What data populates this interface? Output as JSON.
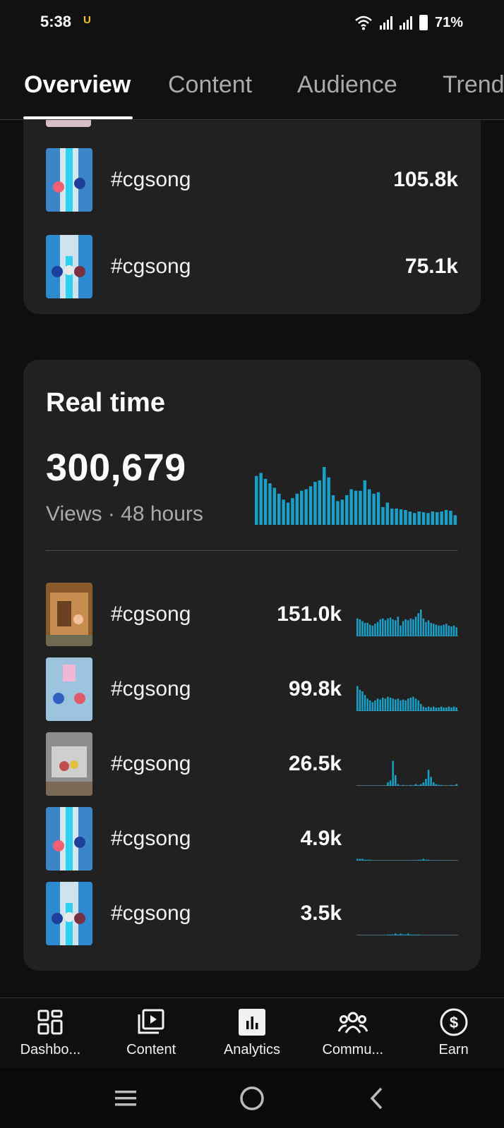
{
  "status_bar": {
    "time": "5:38",
    "app_icon": "U",
    "battery": "71%",
    "icons": [
      "wifi-icon",
      "signal-icon",
      "signal-icon",
      "battery-icon"
    ]
  },
  "tabs": [
    {
      "label": "Overview",
      "active": true
    },
    {
      "label": "Content",
      "active": false
    },
    {
      "label": "Audience",
      "active": false
    },
    {
      "label": "Trends",
      "active": false
    }
  ],
  "top_list": [
    {
      "title": "#cgsong",
      "views": "105.8k"
    },
    {
      "title": "#cgsong",
      "views": "75.1k"
    }
  ],
  "realtime": {
    "title": "Real time",
    "views": "300,679",
    "subtitle": "Views · 48 hours",
    "chart_data": {
      "type": "bar",
      "values": [
        66,
        70,
        62,
        56,
        50,
        42,
        34,
        30,
        36,
        42,
        46,
        48,
        52,
        58,
        60,
        78,
        64,
        40,
        32,
        34,
        40,
        48,
        46,
        46,
        60,
        48,
        42,
        44,
        24,
        30,
        22,
        22,
        21,
        20,
        18,
        16,
        18,
        17,
        16,
        18,
        17,
        18,
        20,
        19,
        13
      ]
    },
    "rows": [
      {
        "title": "#cgsong",
        "views": "151.0k",
        "spark": [
          20,
          19,
          17,
          15,
          15,
          13,
          12,
          14,
          16,
          19,
          20,
          18,
          20,
          21,
          19,
          18,
          22,
          12,
          17,
          19,
          18,
          20,
          19,
          22,
          26,
          30,
          20,
          16,
          18,
          15,
          14,
          13,
          12,
          12,
          13,
          14,
          12,
          11,
          12,
          10
        ]
      },
      {
        "title": "#cgsong",
        "views": "99.8k",
        "spark": [
          28,
          24,
          22,
          18,
          14,
          12,
          10,
          12,
          14,
          13,
          15,
          14,
          16,
          15,
          14,
          13,
          14,
          12,
          13,
          12,
          14,
          15,
          16,
          14,
          12,
          8,
          5,
          4,
          5,
          4,
          5,
          4,
          4,
          5,
          4,
          4,
          5,
          4,
          5,
          4
        ]
      },
      {
        "title": "#cgsong",
        "views": "26.5k",
        "spark": [
          0,
          0,
          0,
          0,
          0,
          0,
          0,
          0,
          0,
          0,
          0,
          0,
          4,
          6,
          28,
          12,
          2,
          0,
          1,
          0,
          0,
          1,
          0,
          2,
          1,
          2,
          4,
          8,
          18,
          10,
          4,
          2,
          1,
          1,
          0,
          0,
          0,
          1,
          0,
          2
        ]
      },
      {
        "title": "#cgsong",
        "views": "4.9k",
        "spark": [
          2,
          2,
          2,
          1,
          1,
          1,
          0,
          0,
          0,
          0,
          0,
          0,
          0,
          0,
          0,
          0,
          0,
          0,
          0,
          0,
          0,
          0,
          0,
          0,
          1,
          1,
          2,
          1,
          1,
          0,
          0,
          0,
          0,
          0,
          0,
          0,
          0,
          0,
          0,
          0
        ]
      },
      {
        "title": "#cgsong",
        "views": "3.5k",
        "spark": [
          0,
          0,
          0,
          0,
          0,
          0,
          0,
          0,
          0,
          0,
          0,
          0,
          1,
          1,
          1,
          2,
          1,
          2,
          1,
          1,
          2,
          1,
          1,
          1,
          1,
          0,
          0,
          0,
          0,
          0,
          0,
          0,
          0,
          0,
          0,
          0,
          0,
          0,
          0,
          0
        ]
      }
    ]
  },
  "bottom_nav": [
    {
      "label": "Dashbo...",
      "icon": "dashboard-icon",
      "active": false
    },
    {
      "label": "Content",
      "icon": "content-icon",
      "active": false
    },
    {
      "label": "Analytics",
      "icon": "analytics-icon",
      "active": true
    },
    {
      "label": "Commu...",
      "icon": "community-icon",
      "active": false
    },
    {
      "label": "Earn",
      "icon": "earn-icon",
      "active": false
    }
  ],
  "colors": {
    "accent_bar": "#1aa0c7",
    "card_bg": "#212121",
    "page_bg": "#0f0f0f"
  }
}
